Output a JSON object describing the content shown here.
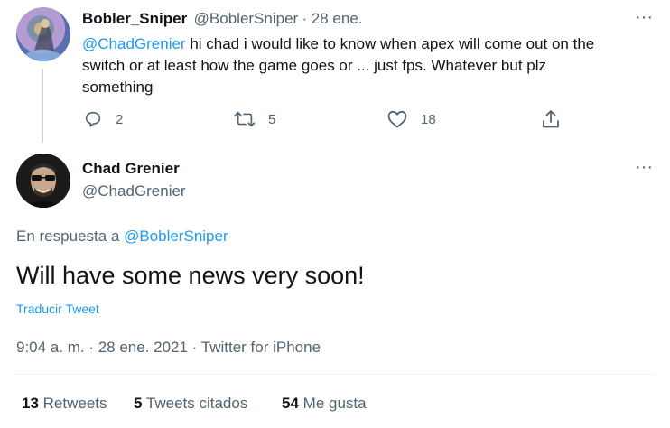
{
  "reply_tweet": {
    "author_name": "Bobler_Sniper",
    "author_handle": "@BoblerSniper",
    "separator": "·",
    "date": "28 ene.",
    "mention": "@ChadGrenier",
    "text_line1": " hi chad i would like to know when apex will come out on the",
    "text_line2": "switch or at least how the game goes or ... just fps. Whatever but plz",
    "text_line3": "something",
    "reply_count": "2",
    "retweet_count": "5",
    "like_count": "18"
  },
  "main_tweet": {
    "author_name": "Chad Grenier",
    "author_handle": "@ChadGrenier",
    "replying_to_label": "En respuesta a",
    "replying_to_handle": "@BoblerSniper",
    "text": "Will have some news very soon!",
    "translate_label": "Traducir Tweet",
    "timestamp": "9:04 a. m. · 28 ene. 2021 · Twitter for iPhone",
    "stats": {
      "retweets_count": "13",
      "retweets_label": "Retweets",
      "quotes_count": "5",
      "quotes_label": "Tweets citados",
      "likes_count": "54",
      "likes_label": "Me gusta"
    }
  },
  "more_icon": "···",
  "colors": {
    "accent": "#1d9bf0",
    "text": "#0f1419",
    "secondary": "#536471",
    "divider": "#eff3f4"
  },
  "icons": [
    "reply-icon",
    "retweet-icon",
    "like-icon",
    "share-icon",
    "more-icon"
  ]
}
